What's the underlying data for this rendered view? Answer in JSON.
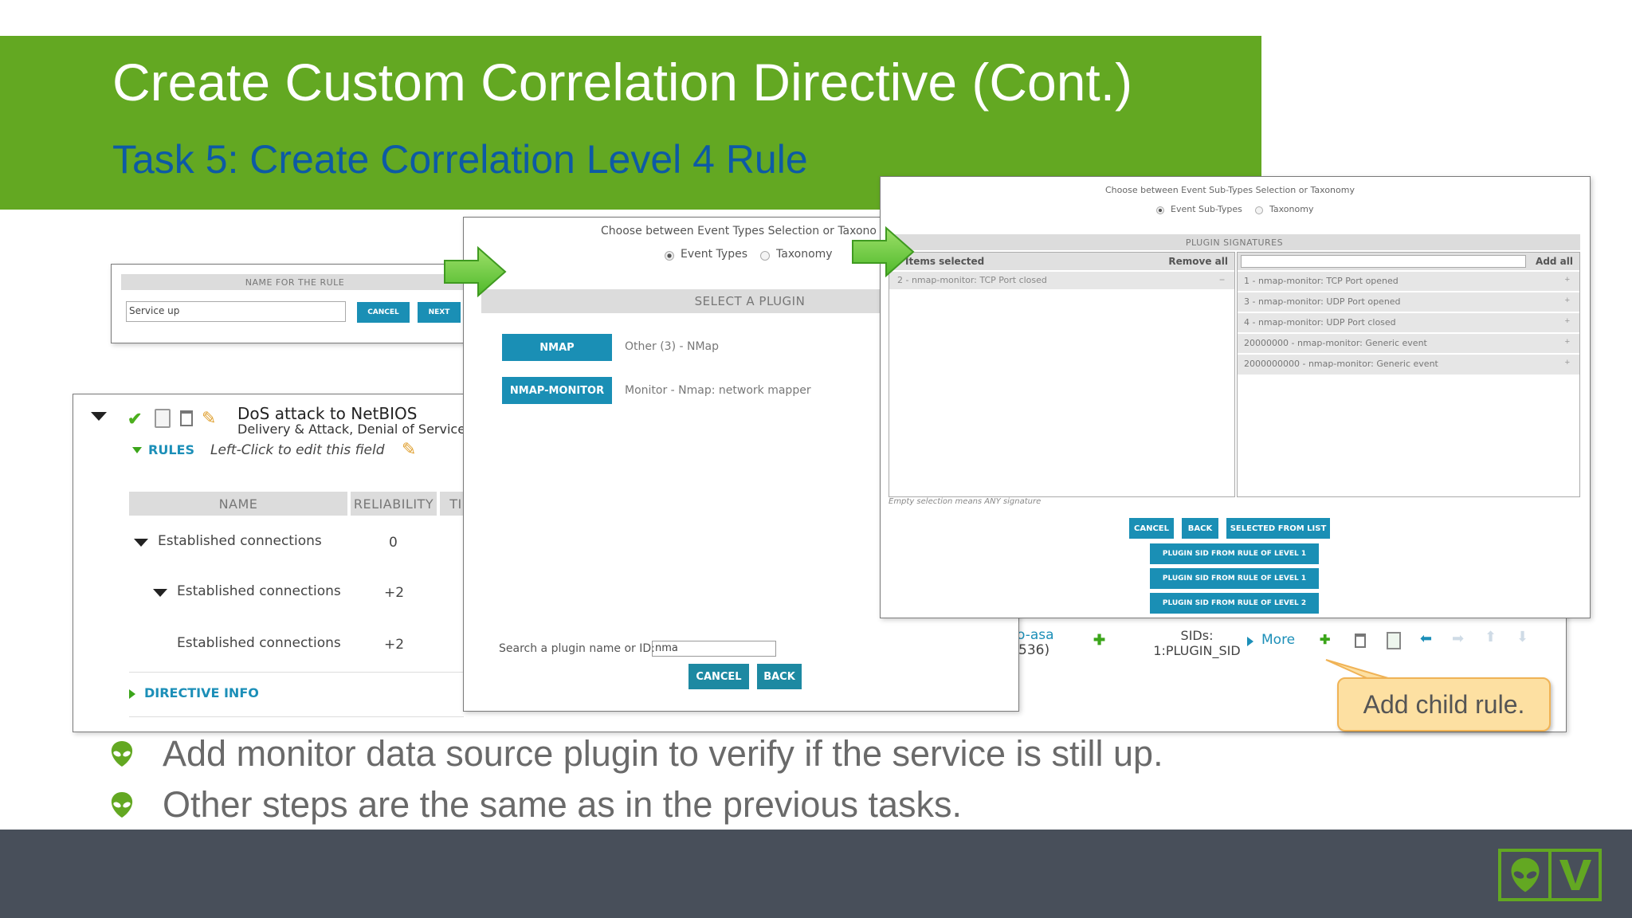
{
  "title": "Create Custom Correlation Directive (Cont.)",
  "subtitle": "Task 5: Create Correlation Level 4 Rule",
  "bullets": [
    "Add monitor data source plugin to verify if the service is still up.",
    "Other steps are the same as in the previous tasks."
  ],
  "callout": "Add child rule.",
  "rule_name_panel": {
    "header": "NAME FOR THE RULE",
    "input_value": "Service up",
    "cancel": "CANCEL",
    "next": "NEXT"
  },
  "directive_panel": {
    "name": "DoS attack to NetBIOS",
    "category": "Delivery & Attack, Denial of Service",
    "rules_label": "RULES",
    "edit_hint": "Left-Click to edit this field",
    "col_name": "NAME",
    "col_reliability": "RELIABILITY",
    "col_time": "TI",
    "rows": [
      {
        "name": "Established connections",
        "reliability": "0"
      },
      {
        "name": "Established connections",
        "reliability": "+2"
      },
      {
        "name": "Established connections",
        "reliability": "+2"
      }
    ],
    "directive_info": "DIRECTIVE INFO",
    "partial_source": "o-asa",
    "partial_source_2": "536)",
    "sids_label": "SIDs:",
    "sids_value": "1:PLUGIN_SID",
    "more": "More"
  },
  "plugin_panel": {
    "choose_text": "Choose between Event Types Selection or Taxono",
    "radio_event_types": "Event Types",
    "radio_taxonomy": "Taxonomy",
    "select_header": "SELECT A PLUGIN",
    "plugins": [
      {
        "button": "NMAP",
        "desc": "Other (3) - NMap"
      },
      {
        "button": "NMAP-MONITOR",
        "desc": "Monitor - Nmap: network mapper"
      }
    ],
    "search_label": "Search a plugin name or ID:",
    "search_value": "nma",
    "cancel": "CANCEL",
    "back": "BACK"
  },
  "sig_panel": {
    "choose_text": "Choose between Event Sub-Types Selection or Taxonomy",
    "radio_sub_types": "Event Sub-Types",
    "radio_taxonomy": "Taxonomy",
    "header": "PLUGIN SIGNATURES",
    "items_selected": "Items selected",
    "remove_all": "Remove all",
    "add_all": "Add all",
    "selected": [
      "2 - nmap-monitor: TCP Port closed"
    ],
    "available": [
      "1 - nmap-monitor: TCP Port opened",
      "3 - nmap-monitor: UDP Port opened",
      "4 - nmap-monitor: UDP Port closed",
      "20000000 - nmap-monitor: Generic event",
      "2000000000 - nmap-monitor: Generic event"
    ],
    "empty_note": "Empty selection means ANY signature",
    "cancel": "CANCEL",
    "back": "BACK",
    "selected_from_list": "SELECTED FROM LIST",
    "level_buttons": [
      "PLUGIN SID FROM RULE OF LEVEL 1",
      "PLUGIN SID FROM RULE OF LEVEL 1",
      "PLUGIN SID FROM RULE OF LEVEL 2"
    ]
  },
  "colors": {
    "banner_green": "#63a822",
    "subtitle_blue": "#0d5aa5",
    "footer_gray": "#484f5a",
    "button_blue": "#1a8fb5",
    "callout_bg": "#fde0a2"
  }
}
